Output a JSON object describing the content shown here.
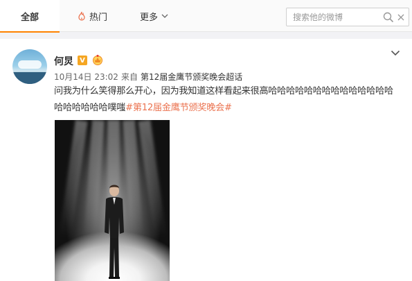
{
  "tabs": {
    "all": "全部",
    "hot": "热门",
    "more": "更多"
  },
  "search": {
    "placeholder": "搜索他的微博"
  },
  "post": {
    "username": "何炅",
    "verified_badge": "V",
    "date": "10月14日 23:02",
    "from_label": "来自",
    "source": "第12届金鹰节颁奖晚会超话",
    "text": "问我为什么笑得那么开心，因为我知道这样看起来很高哈哈哈哈哈哈哈哈哈哈哈哈哈哈哈哈哈哈哈哈噗嗤",
    "topic": "#第12届金鹰节颁奖晚会#"
  },
  "colors": {
    "accent_orange": "#ff8200",
    "topic_link": "#eb7350",
    "verified_badge": "#f5a623"
  },
  "icons": {
    "hot": "flame-icon",
    "more": "chevron-down-icon",
    "search": "search-icon",
    "clear": "clear-icon",
    "expand": "chevron-down-icon",
    "member": "crown-icon"
  }
}
